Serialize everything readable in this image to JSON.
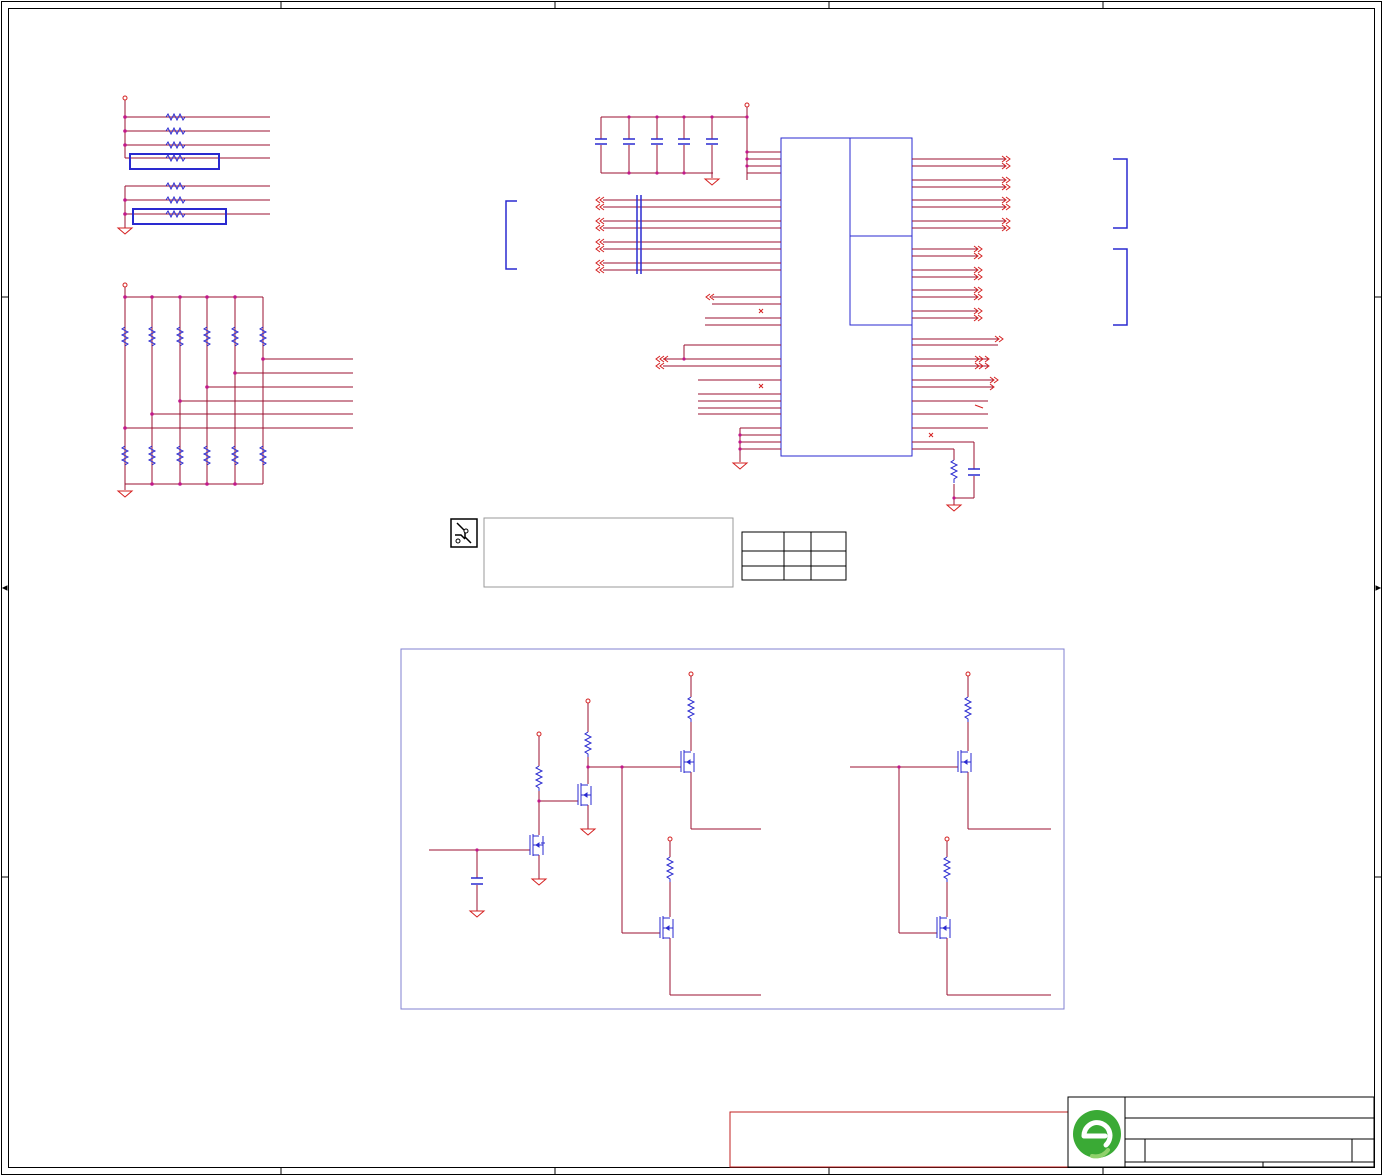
{
  "sheet": {
    "background": "#ffffff",
    "colors": {
      "border": "#000000",
      "wire": "#9b1030",
      "component": "#2a2ad0",
      "junction": "#c2188b",
      "net_flag": "#d42020",
      "region_box": "#8080d0",
      "note_box": "#c02020",
      "logo_green": "#3aaa35"
    },
    "icons": [
      "pcb-trace-icon",
      "company-logo-icon"
    ]
  },
  "title_block": {
    "title": "",
    "sheet_name": "",
    "revision": ""
  },
  "info_table": {
    "rows": [
      [
        "",
        "",
        ""
      ],
      [
        "",
        "",
        ""
      ]
    ]
  },
  "note": {
    "text": ""
  }
}
